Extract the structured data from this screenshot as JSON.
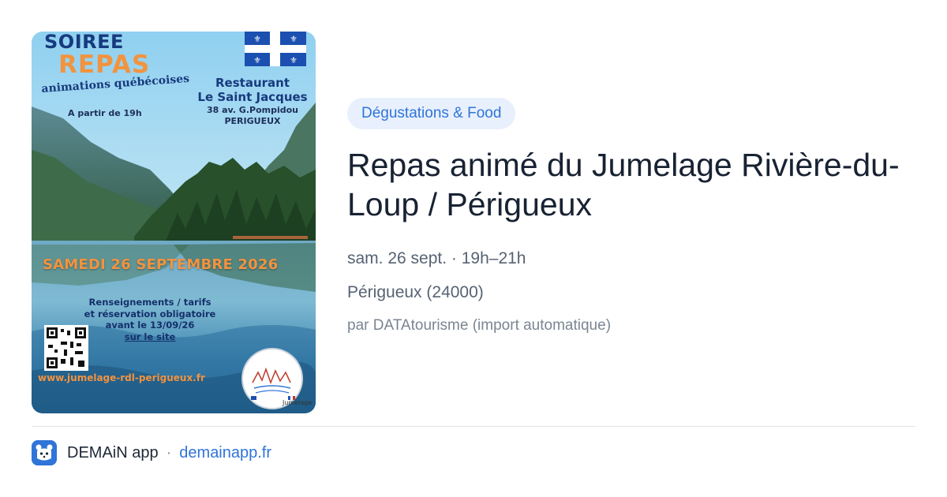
{
  "poster": {
    "title_line1": "SOIREE",
    "title_line2": "REPAS",
    "animations": "animations québécoises",
    "start_time": "A partir de 19h",
    "restaurant_label": "Restaurant",
    "restaurant_name": "Le Saint Jacques",
    "address": "38 av. G.Pompidou",
    "city": "PERIGUEUX",
    "date": "SAMEDI 26 SEPTEMBRE 2026",
    "info_line1": "Renseignements / tarifs",
    "info_line2": "et réservation obligatoire",
    "info_line3": "avant le 13/09/26",
    "info_line4": "sur le site",
    "website": "www.jumelage-rdl-perigueux.fr",
    "badge_text": "RIVIÈRE-DU-LOUP · PÉRIGUEUX",
    "badge_bottom": "Jumelage"
  },
  "event": {
    "category": "Dégustations & Food",
    "title": "Repas animé du Jumelage Rivière-du-Loup / Périgueux",
    "datetime": "sam. 26 sept. · 19h–21h",
    "location": "Périgueux (24000)",
    "source": "par DATAtourisme (import automatique)"
  },
  "footer": {
    "app_name": "DEMAiN app",
    "separator": "·",
    "domain": "demainapp.fr"
  },
  "colors": {
    "accent": "#2f74d8",
    "tag_bg": "#e8f0fd",
    "title": "#182233",
    "meta": "#566273",
    "poster_orange": "#f2933f",
    "poster_navy": "#173a7e"
  }
}
